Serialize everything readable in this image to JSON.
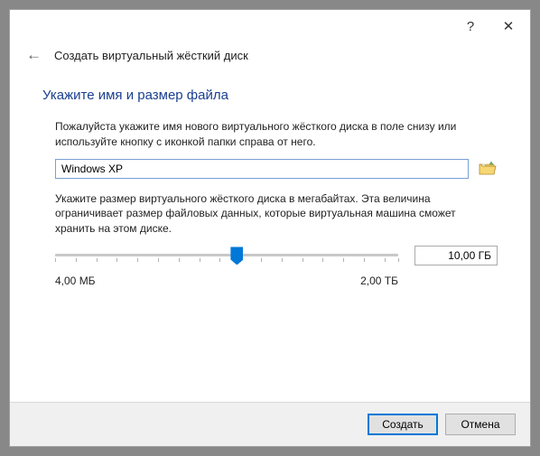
{
  "titlebar": {
    "help": "?",
    "close": "✕"
  },
  "header": {
    "back": "←",
    "title": "Создать виртуальный жёсткий диск"
  },
  "section": {
    "title": "Укажите имя и размер файла",
    "desc1": "Пожалуйста укажите имя нового виртуального жёсткого диска в поле снизу или используйте кнопку с иконкой папки справа от него.",
    "desc2": "Укажите размер виртуального жёсткого диска в мегабайтах. Эта величина ограничивает размер файловых данных, которые виртуальная машина сможет хранить на этом диске."
  },
  "file": {
    "value": "Windows XP"
  },
  "slider": {
    "min_label": "4,00 МБ",
    "max_label": "2,00 ТБ",
    "size_value": "10,00 ГБ"
  },
  "footer": {
    "create": "Создать",
    "cancel": "Отмена"
  }
}
